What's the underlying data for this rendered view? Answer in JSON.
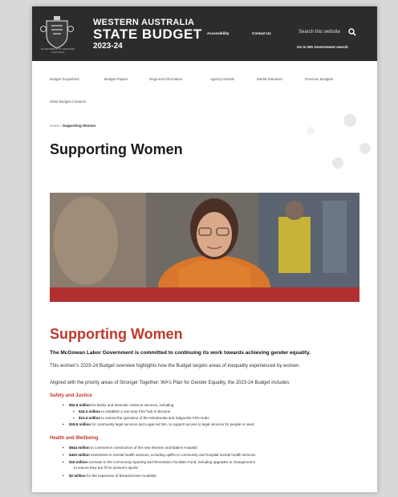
{
  "header": {
    "crest_label": "GOVERNMENT OF WESTERN AUSTRALIA",
    "title_line1": "WESTERN AUSTRALIA",
    "title_line2": "STATE BUDGET",
    "title_line3": "2023-24",
    "accessibility": "Accessibility",
    "contact_us": "Contact Us",
    "search_placeholder": "Search this website",
    "wa_search": "Go to WA Government search"
  },
  "nav": {
    "items": [
      "Budget Snapshots",
      "Budget Papers",
      "Regional Information",
      "Agency Details",
      "Media Releases",
      "Previous Budgets",
      "State Budget Contacts"
    ]
  },
  "breadcrumb": {
    "home": "Home",
    "separator": "/",
    "current": "Supporting Women"
  },
  "page_title": "Supporting Women",
  "content": {
    "section_title": "Supporting Women",
    "lead": "The McGowan Labor Government is committed to continuing its work towards achieving gender equality.",
    "intro": "This women's 2023-24 Budget overview highlights how the Budget targets areas of inequality experienced by women.",
    "aligned": "Aligned with the priority areas of Stronger Together: WA's Plan for Gender Equality, the 2023-24 Budget includes:",
    "safety": {
      "heading": "Safety and Justice",
      "b1_amt": "$52.5 million",
      "b1_txt": " for family and domestic violence services, including:",
      "b1a_amt": "$16.3 million",
      "b1a_txt": " to establish a one-stop FDV hub in Broome",
      "b1b_amt": "$13.4 million",
      "b1b_txt": " to extend the operation of the Mirrabooka and Kalgoorlie FDV Hubs",
      "b2_amt": "$18.9 million",
      "b2_txt": " for community legal services and Legal Aid WA, to support access to legal services for people in need"
    },
    "health": {
      "heading": "Health and Wellbeing",
      "b1_amt": "$544 million",
      "b1_txt": " to commence construction of the new Women and Babies Hospital",
      "b2_amt": "$420 million",
      "b2_txt": " investment in mental health services, including uplifts to community and hospital mental health services",
      "b3_amt": "$15 million",
      "b3_txt": " increase to the Community Sporting and Recreation Facilities Fund, including upgrades to changerooms",
      "b3_cont": "to ensure they are fit for women's sports",
      "b4_amt": "$2 million",
      "b4_txt": " for the expansion of BreastScreen Australia"
    }
  },
  "colors": {
    "header_bg": "#2c2c2c",
    "accent_red": "#c0392b",
    "hero_band": "#b03030"
  }
}
